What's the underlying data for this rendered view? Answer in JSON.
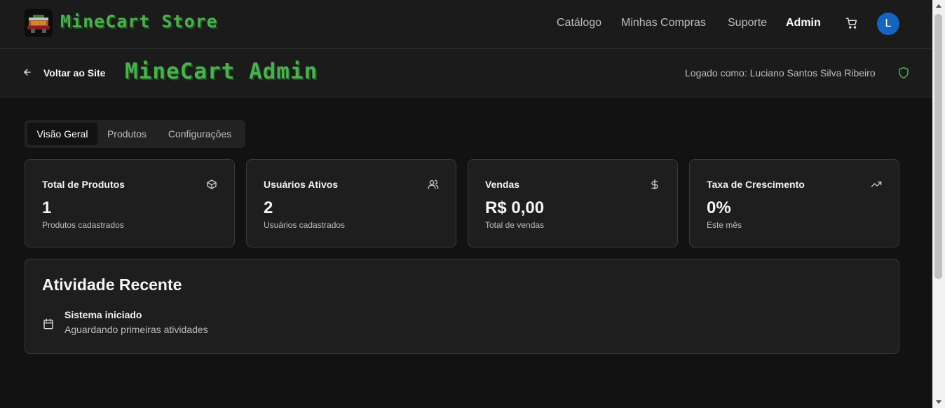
{
  "navbar": {
    "brand": "MineCart Store",
    "links": [
      "Catálogo",
      "Minhas Compras",
      "Suporte",
      "Admin"
    ],
    "active_link": "Admin",
    "cart_icon": "shopping-cart-icon",
    "avatar_letter": "L",
    "avatar_color": "#1565c0"
  },
  "admin_header": {
    "back_label": "Voltar ao Site",
    "title": "MineCart Admin",
    "logged_in_text": "Logado como: Luciano Santos Silva Ribeiro",
    "shield_icon": "shield-icon"
  },
  "tabs": [
    {
      "label": "Visão Geral",
      "active": true
    },
    {
      "label": "Produtos",
      "active": false
    },
    {
      "label": "Configurações",
      "active": false
    }
  ],
  "stats": [
    {
      "title": "Total de Produtos",
      "value": "1",
      "subtitle": "Produtos cadastrados",
      "icon": "package-icon"
    },
    {
      "title": "Usuários Ativos",
      "value": "2",
      "subtitle": "Usuários cadastrados",
      "icon": "users-icon"
    },
    {
      "title": "Vendas",
      "value": "R$ 0,00",
      "subtitle": "Total de vendas",
      "icon": "dollar-icon"
    },
    {
      "title": "Taxa de Crescimento",
      "value": "0%",
      "subtitle": "Este mês",
      "icon": "trending-up-icon"
    }
  ],
  "activity": {
    "title": "Atividade Recente",
    "items": [
      {
        "title": "Sistema iniciado",
        "description": "Aguardando primeiras atividades",
        "icon": "calendar-icon"
      }
    ]
  },
  "colors": {
    "brand_green": "#4caf50",
    "background": "#121212",
    "surface": "#1e1e1e",
    "header": "#1b1b1b",
    "border": "#3a3a3a"
  }
}
